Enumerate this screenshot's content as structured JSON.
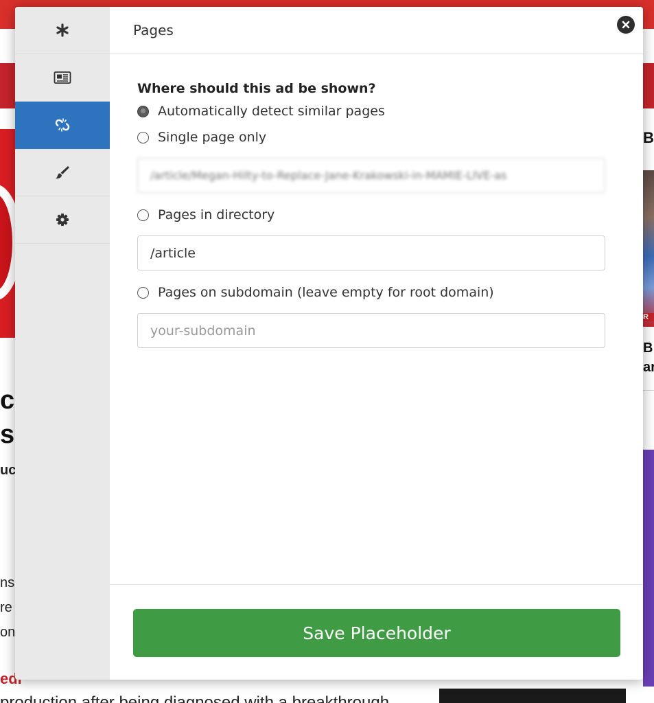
{
  "background_page": {
    "headline_fragments": [
      "c",
      "s"
    ],
    "subtitle_fragment": "uct",
    "body_fragments": [
      "ns",
      "re",
      "on"
    ],
    "red_link_fragment": "edl",
    "bottom_text": "production after being diagnosed with a breakthrough",
    "right_col_letters": [
      "B",
      "R",
      "B",
      "ar"
    ]
  },
  "modal": {
    "title": "Pages",
    "sidebar": [
      {
        "icon": "asterisk-icon"
      },
      {
        "icon": "newspaper-icon"
      },
      {
        "icon": "unlink-icon",
        "active": true
      },
      {
        "icon": "paintbrush-icon"
      },
      {
        "icon": "gear-icon"
      }
    ],
    "question": "Where should this ad be shown?",
    "options": {
      "auto": {
        "label": "Automatically detect similar pages",
        "checked": true
      },
      "single": {
        "label": "Single page only",
        "checked": false,
        "value": "/article/Megan-Hilty-to-Replace-Jane-Krakowski-in-MAMIE-LIVE-as"
      },
      "directory": {
        "label": "Pages in directory",
        "checked": false,
        "value": "/article"
      },
      "subdomain": {
        "label": "Pages on subdomain (leave empty for root domain)",
        "checked": false,
        "placeholder": "your-subdomain"
      }
    },
    "save_label": "Save Placeholder",
    "colors": {
      "active_sidebar": "#2e73be",
      "save_button": "#3f9c45",
      "page_red": "#c4242b"
    }
  }
}
